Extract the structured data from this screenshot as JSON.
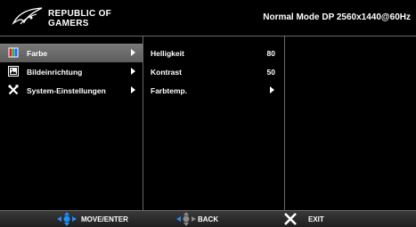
{
  "header": {
    "brand_line1": "REPUBLIC OF",
    "brand_line2": "GAMERS",
    "status": "Normal Mode DP 2560x1440@60Hz"
  },
  "menu": {
    "items": [
      {
        "label": "Farbe",
        "icon": "color-palette-icon",
        "selected": true
      },
      {
        "label": "Bildeinrichtung",
        "icon": "image-icon",
        "selected": false
      },
      {
        "label": "System-Einstellungen",
        "icon": "tools-icon",
        "selected": false
      }
    ]
  },
  "submenu": {
    "items": [
      {
        "label": "Helligkeit",
        "value": "80"
      },
      {
        "label": "Kontrast",
        "value": "50"
      },
      {
        "label": "Farbtemp.",
        "value": ""
      }
    ]
  },
  "footer": {
    "move_label": "MOVE/ENTER",
    "back_label": "BACK",
    "exit_label": "EXIT"
  },
  "colors": {
    "accent_blue": "#1e8fff",
    "selected_bg": "#6a6a6a",
    "divider": "#6a6a6a"
  }
}
